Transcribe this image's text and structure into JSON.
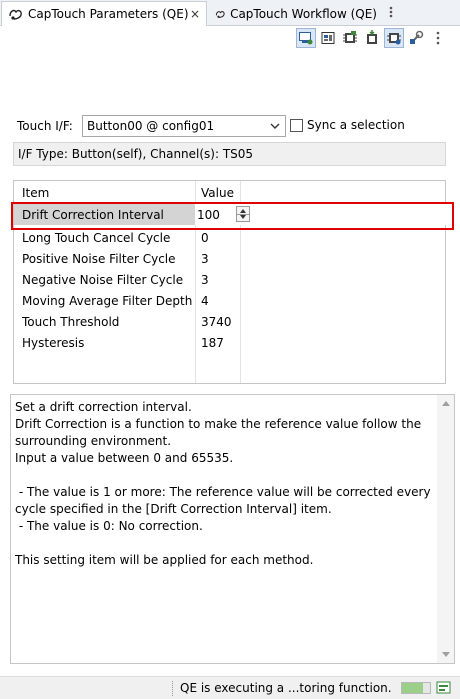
{
  "tabs": [
    {
      "label": "CapTouch Parameters (QE)",
      "close": "×"
    },
    {
      "label": "CapTouch Workflow (QE)"
    }
  ],
  "form": {
    "touch_if_label": "Touch I/F:",
    "touch_if_value": "Button00 @ config01",
    "sync_label": "Sync a selection",
    "if_type": "I/F Type: Button(self), Channel(s): TS05"
  },
  "table": {
    "headers": [
      "Item",
      "Value"
    ],
    "rows": [
      {
        "item": "Drift Correction Interval",
        "value": "100"
      },
      {
        "item": "Long Touch Cancel Cycle",
        "value": "0"
      },
      {
        "item": "Positive Noise Filter Cycle",
        "value": "3"
      },
      {
        "item": "Negative Noise Filter Cycle",
        "value": "3"
      },
      {
        "item": "Moving Average Filter Depth",
        "value": "4"
      },
      {
        "item": "Touch Threshold",
        "value": "3740"
      },
      {
        "item": "Hysteresis",
        "value": "187"
      }
    ]
  },
  "description": {
    "lines": [
      "Set a drift correction interval.",
      "Drift Correction is a function to make the reference value follow the",
      "surrounding environment.",
      "Input a value between 0 and 65535.",
      "",
      " - The value is 1 or more: The reference value will be corrected every",
      "cycle specified in the [Drift Correction Interval] item.",
      " - The value is 0: No correction.",
      "",
      "This setting item will be applied for each method."
    ]
  },
  "status": {
    "text": "QE is executing a ...toring function.",
    "progress": 0.75
  },
  "colors": {
    "highlight": "#e00000",
    "tab_bar": "#eef1f5",
    "selected_cell": "#d4d4d4"
  },
  "icons": [
    "captouch-tab-icon",
    "close-icon",
    "view-menu-icon",
    "toolbar-monitor-icon",
    "toolbar-board-icon",
    "toolbar-chip-icon",
    "toolbar-chip-download-icon",
    "toolbar-chip-config-icon",
    "toolbar-settings-icon",
    "toolbar-menu-icon",
    "dropdown-arrow-icon",
    "spin-up-icon",
    "spin-down-icon"
  ]
}
